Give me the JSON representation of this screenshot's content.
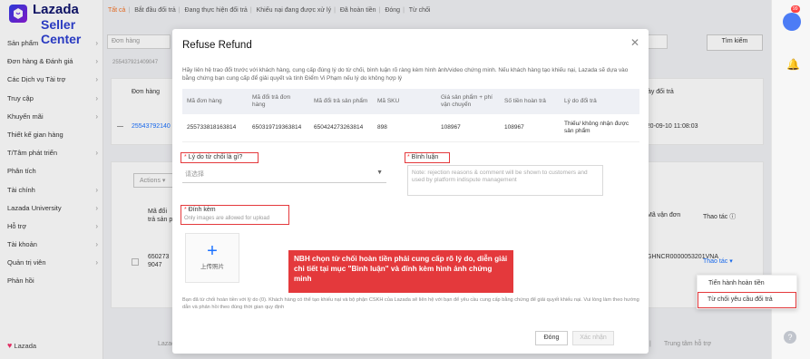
{
  "brand": {
    "name": "Lazada",
    "sub": "Seller Center",
    "footer": "Lazada"
  },
  "tabs": [
    "Tất cả",
    "Bắt đầu đổi trả",
    "Đang thực hiện đổi trả",
    "Khiếu nại đang được xử lý",
    "Đã hoàn tiền",
    "Đóng",
    "Từ chối"
  ],
  "sidebar": {
    "items": [
      "Sản phẩm",
      "Đơn hàng & Đánh giá",
      "Các Dịch vụ Tài trợ",
      "Truy cập",
      "Khuyến mãi",
      "Thiết kế gian hàng",
      "T/Tâm phát triển",
      "Phân tích",
      "Tài chính",
      "Lazada University",
      "Hỗ trợ",
      "Tài khoản",
      "Quản trị viên",
      "Phản hồi"
    ]
  },
  "background": {
    "search_placeholder": "Đơn hàng",
    "order_chip": "255437921409047",
    "search_button": "Tìm kiếm",
    "col_order": "Đơn hàng",
    "col_return_date": "Ngày đổi trả",
    "row_order_id": "25543792140",
    "row_return_date": "2020-09-10 11:08:03",
    "actions_label": "Actions",
    "col_return_code": "Mã đổi trả sản p",
    "col_waybill": "Mã vận đơn",
    "col_action": "Thao tác",
    "row2_code": "650273 9047",
    "row2_waybill": "GHNCR0000053201VNA",
    "row2_action": "Thao tác",
    "footer_left": "Lazada",
    "footer_right": "Trung tâm hỗ trợ"
  },
  "modal": {
    "title": "Refuse Refund",
    "description": "Hãy liên hệ trao đổi trước với khách hàng, cung cấp đúng lý do từ chối, bình luận rõ ràng kèm hình ảnh/video chứng minh. Nếu khách hàng tạo khiếu nại, Lazada sẽ dựa vào bằng chứng bạn cung cấp để giải quyết và tính Điểm Vi Phạm nếu lý do không hợp lý",
    "table": {
      "headers": [
        "Mã đơn hàng",
        "Mã đổi trả đơn hàng",
        "Mã đổi trả sản phẩm",
        "Mã SKU",
        "Giá sản phẩm + phí vận chuyển",
        "Số tiền hoàn trả",
        "Lý do đổi trả"
      ],
      "row": [
        "255733818163814",
        "650319719363814",
        "650424273263814",
        "898",
        "108967",
        "108967",
        "Thiếu/ không nhận được sản phẩm"
      ]
    },
    "reason_label": "Lý do từ chối là gì?",
    "reason_placeholder": "请选择",
    "comment_label": "Bình luận",
    "comment_placeholder": "Note: rejection reasons & comment will be shown to customers and used by platform indispute management",
    "attach_label": "Đính kèm",
    "attach_note": "Only images are allowed for upload",
    "upload_text": "上传照片",
    "annotation": "NBH chọn từ chối hoàn tiền phải cung cấp rõ lý do, diễn giải chi tiết tại mục \"Bình luận\" và đính kèm hình ảnh chứng minh",
    "footnote": "Bạn đã từ chối hoàn tiền với lý do (0). Khách hàng có thể tạo khiếu nại và bộ phận CSKH của Lazada sẽ liên hệ với bạn để yêu cầu cung cấp bằng chứng để giải quyết khiếu nại. Vui lòng làm theo hướng dẫn và phản hồi theo đúng thời gian quy định",
    "close_btn": "Đóng",
    "confirm_btn": "Xác nhận"
  },
  "dropdown": {
    "items": [
      "Tiến hành hoàn tiền",
      "Từ chối yêu cầu đổi trả"
    ]
  },
  "right_strip": {
    "badge": "99"
  },
  "colors": {
    "accent": "#f57224",
    "link": "#1a71ff",
    "annotation_red": "#e4393c"
  }
}
